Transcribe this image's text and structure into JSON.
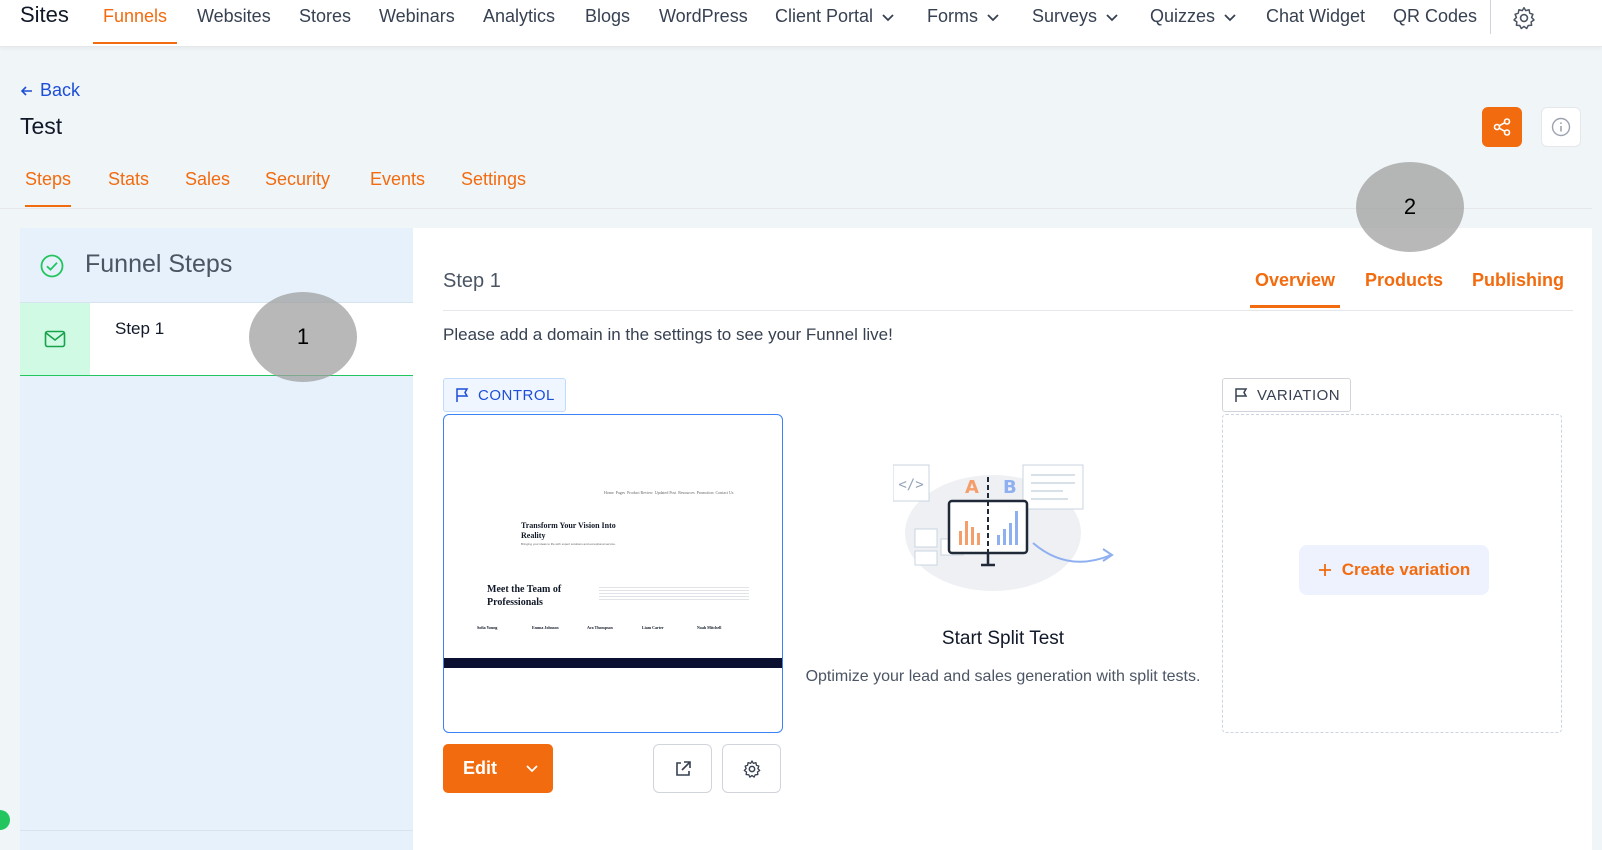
{
  "topnav": {
    "brand": "Sites",
    "items": [
      {
        "label": "Funnels",
        "active": true
      },
      {
        "label": "Websites"
      },
      {
        "label": "Stores"
      },
      {
        "label": "Webinars"
      },
      {
        "label": "Analytics"
      },
      {
        "label": "Blogs"
      },
      {
        "label": "WordPress"
      },
      {
        "label": "Client Portal",
        "dropdown": true
      },
      {
        "label": "Forms",
        "dropdown": true
      },
      {
        "label": "Surveys",
        "dropdown": true
      },
      {
        "label": "Quizzes",
        "dropdown": true
      },
      {
        "label": "Chat Widget"
      },
      {
        "label": "QR Codes"
      }
    ]
  },
  "header": {
    "back_label": "Back",
    "title": "Test"
  },
  "tabs": [
    "Steps",
    "Stats",
    "Sales",
    "Security",
    "Events",
    "Settings"
  ],
  "funnel_steps": {
    "title": "Funnel Steps",
    "steps": [
      {
        "label": "Step 1"
      }
    ]
  },
  "step_panel": {
    "title": "Step 1",
    "tabs": [
      "Overview",
      "Products",
      "Publishing"
    ],
    "notice": "Please add a domain in the settings to see your Funnel live!",
    "control_label": "CONTROL",
    "variation_label": "VARIATION",
    "preview": {
      "heading": "Transform Your Vision Into Reality",
      "team_heading": "Meet the Team of Professionals",
      "team": [
        "Sofia Young",
        "Emma Johnson",
        "Ava Thompson",
        "Liam Carter",
        "Noah Mitchell"
      ]
    },
    "edit_label": "Edit",
    "split_test": {
      "title": "Start Split Test",
      "description": "Optimize your lead and sales generation with split tests."
    },
    "create_variation_label": "Create variation"
  },
  "annotations": [
    "1",
    "2"
  ],
  "colors": {
    "accent": "#f26b0f",
    "link": "#1d4ed8",
    "success": "#22c55e"
  }
}
